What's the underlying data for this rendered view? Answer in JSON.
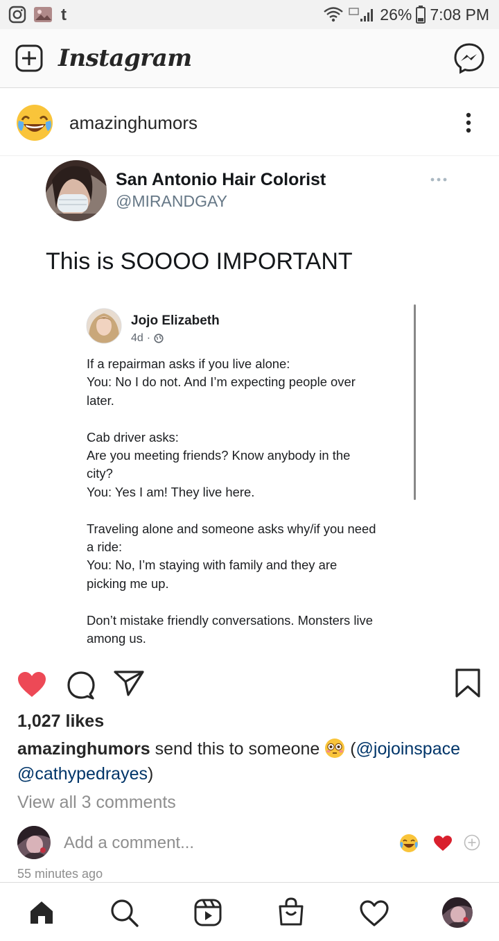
{
  "status_bar": {
    "battery": "26%",
    "time": "7:08 PM"
  },
  "app_bar": {
    "brand": "Instagram"
  },
  "post": {
    "username": "amazinghumors",
    "media": {
      "tweet_name": "San Antonio Hair Colorist",
      "tweet_handle": "@MIRANDGAY",
      "tweet_text": "This is SOOOO IMPORTANT",
      "fb_name": "Jojo Elizabeth",
      "fb_time": "4d",
      "fb_lines": [
        "If a repairman asks if you live alone:",
        "You: No I do not. And I’m expecting people over",
        "later.",
        "Cab driver asks:",
        "Are you meeting friends? Know anybody in the",
        "city?",
        "You: Yes I am! They live here.",
        "Traveling alone and someone asks why/if you need",
        "a ride:",
        "You: No, I’m staying with family and they are",
        "picking me up.",
        "Don’t mistake friendly conversations. Monsters live",
        "among us."
      ]
    },
    "likes": "1,027 likes",
    "caption_user": "amazinghumors",
    "caption_text": "send this to someone",
    "caption_open": "(",
    "mention1": "@jojoinspace",
    "mention2": "@cathypedrayes",
    "caption_close": ")",
    "view_all": "View all 3 comments",
    "add_comment_placeholder": "Add a comment...",
    "time_ago": "55 minutes ago"
  },
  "colors": {
    "like_red": "#ed4956",
    "mention_blue": "#003569",
    "muted_gray": "#8e8e8e"
  }
}
